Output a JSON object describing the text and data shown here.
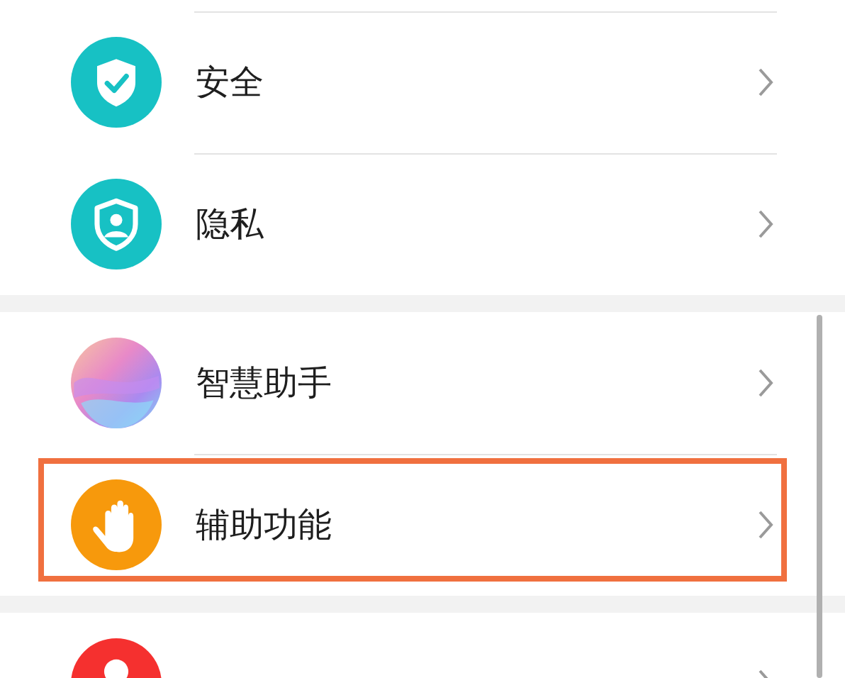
{
  "groups": [
    {
      "items": [
        {
          "label": "安全",
          "kind": "shield-check",
          "highlighted": false
        },
        {
          "label": "隐私",
          "kind": "shield-person",
          "highlighted": false
        }
      ]
    },
    {
      "items": [
        {
          "label": "智慧助手",
          "kind": "orb",
          "highlighted": false
        },
        {
          "label": "辅助功能",
          "kind": "hand",
          "highlighted": true
        }
      ]
    },
    {
      "items": [
        {
          "kind": "person",
          "highlighted": false
        }
      ]
    }
  ]
}
